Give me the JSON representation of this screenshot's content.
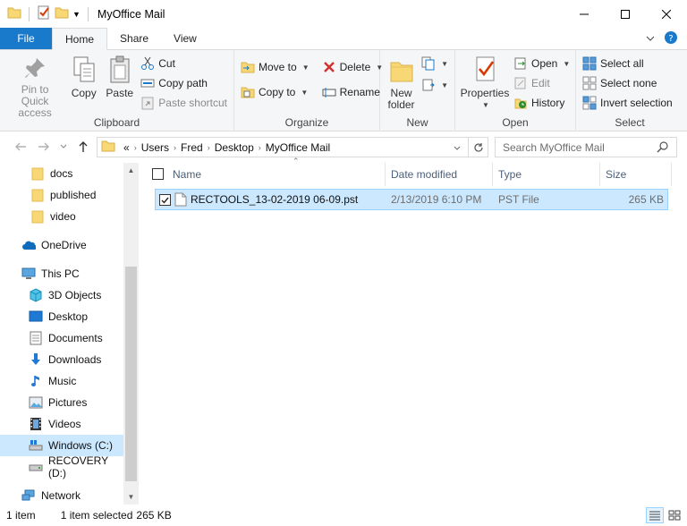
{
  "window": {
    "title": "MyOffice Mail"
  },
  "tabs": {
    "file": "File",
    "home": "Home",
    "share": "Share",
    "view": "View"
  },
  "ribbon": {
    "clipboard": {
      "label": "Clipboard",
      "pin": "Pin to Quick access",
      "pin_line1": "Pin to Quick",
      "pin_line2": "access",
      "copy": "Copy",
      "paste": "Paste",
      "cut": "Cut",
      "copy_path": "Copy path",
      "paste_shortcut": "Paste shortcut"
    },
    "organize": {
      "label": "Organize",
      "move_to": "Move to",
      "copy_to": "Copy to",
      "delete": "Delete",
      "rename": "Rename"
    },
    "new": {
      "label": "New",
      "new_folder_line1": "New",
      "new_folder_line2": "folder"
    },
    "open": {
      "label": "Open",
      "properties": "Properties",
      "open": "Open",
      "edit": "Edit",
      "history": "History"
    },
    "select": {
      "label": "Select",
      "select_all": "Select all",
      "select_none": "Select none",
      "invert": "Invert selection"
    }
  },
  "address": {
    "prefix": "«",
    "crumbs": [
      "Users",
      "Fred",
      "Desktop",
      "MyOffice Mail"
    ]
  },
  "search": {
    "placeholder": "Search MyOffice Mail"
  },
  "nav": {
    "items": [
      {
        "label": "docs",
        "icon": "folder-icon"
      },
      {
        "label": "published",
        "icon": "folder-icon"
      },
      {
        "label": "video",
        "icon": "folder-icon"
      },
      {
        "label": "OneDrive",
        "icon": "cloud-icon"
      },
      {
        "label": "This PC",
        "icon": "computer-icon"
      },
      {
        "label": "3D Objects",
        "icon": "cube-icon"
      },
      {
        "label": "Desktop",
        "icon": "desktop-icon"
      },
      {
        "label": "Documents",
        "icon": "document-icon"
      },
      {
        "label": "Downloads",
        "icon": "download-icon"
      },
      {
        "label": "Music",
        "icon": "music-icon"
      },
      {
        "label": "Pictures",
        "icon": "picture-icon"
      },
      {
        "label": "Videos",
        "icon": "film-icon"
      },
      {
        "label": "Windows (C:)",
        "icon": "drive-icon"
      },
      {
        "label": "RECOVERY (D:)",
        "icon": "drive-icon"
      },
      {
        "label": "Network",
        "icon": "network-icon"
      }
    ],
    "selected": "Windows (C:)"
  },
  "columns": {
    "name": "Name",
    "date": "Date modified",
    "type": "Type",
    "size": "Size"
  },
  "files": [
    {
      "name": "RECTOOLS_13-02-2019 06-09.pst",
      "date": "2/13/2019 6:10 PM",
      "type": "PST File",
      "size": "265 KB"
    }
  ],
  "status": {
    "count": "1 item",
    "selected": "1 item selected",
    "size": "265 KB"
  },
  "colors": {
    "accent": "#1979ca",
    "selection": "#cce8ff",
    "folder": "#f8d775"
  }
}
